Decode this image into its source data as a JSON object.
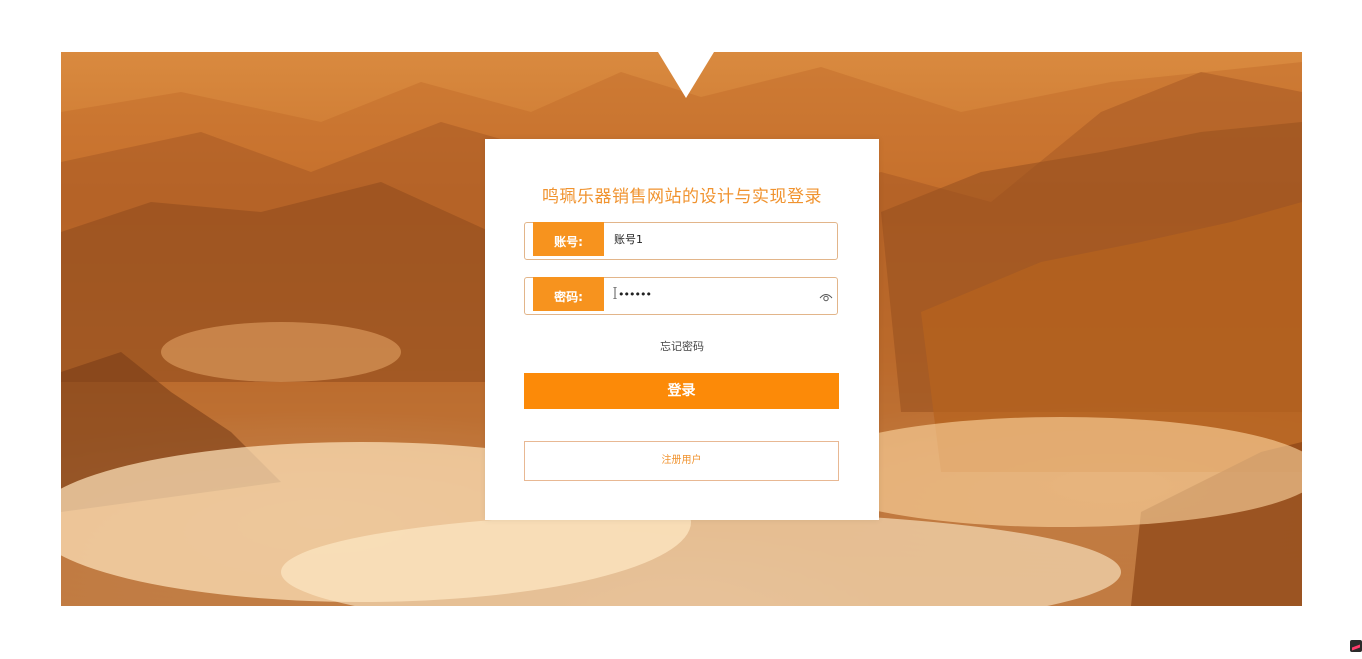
{
  "login": {
    "title": "鸣珮乐器销售网站的设计与实现登录",
    "account_label": "账号:",
    "account_value": "账号1",
    "password_label": "密码:",
    "password_value": "••••••",
    "forgot_password": "忘记密码",
    "login_button": "登录",
    "register_button": "注册用户"
  },
  "colors": {
    "accent": "#f7931e",
    "button": "#fc8a08",
    "title": "#f0932f"
  },
  "icons": {
    "password_toggle": "eye-icon",
    "corner": "app-badge-icon"
  }
}
